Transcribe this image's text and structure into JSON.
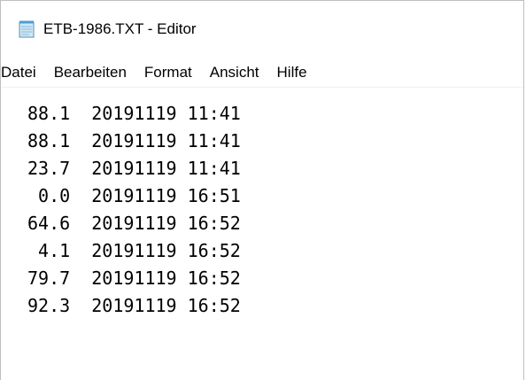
{
  "window": {
    "title": "ETB-1986.TXT - Editor",
    "icon": "notepad-icon"
  },
  "menu": {
    "items": [
      {
        "label": "Datei"
      },
      {
        "label": "Bearbeiten"
      },
      {
        "label": "Format"
      },
      {
        "label": "Ansicht"
      },
      {
        "label": "Hilfe"
      }
    ]
  },
  "document": {
    "lines": [
      "88.1  20191119 11:41",
      "88.1  20191119 11:41",
      "23.7  20191119 11:41",
      " 0.0  20191119 16:51",
      "64.6  20191119 16:52",
      " 4.1  20191119 16:52",
      "79.7  20191119 16:52",
      "92.3  20191119 16:52"
    ]
  }
}
